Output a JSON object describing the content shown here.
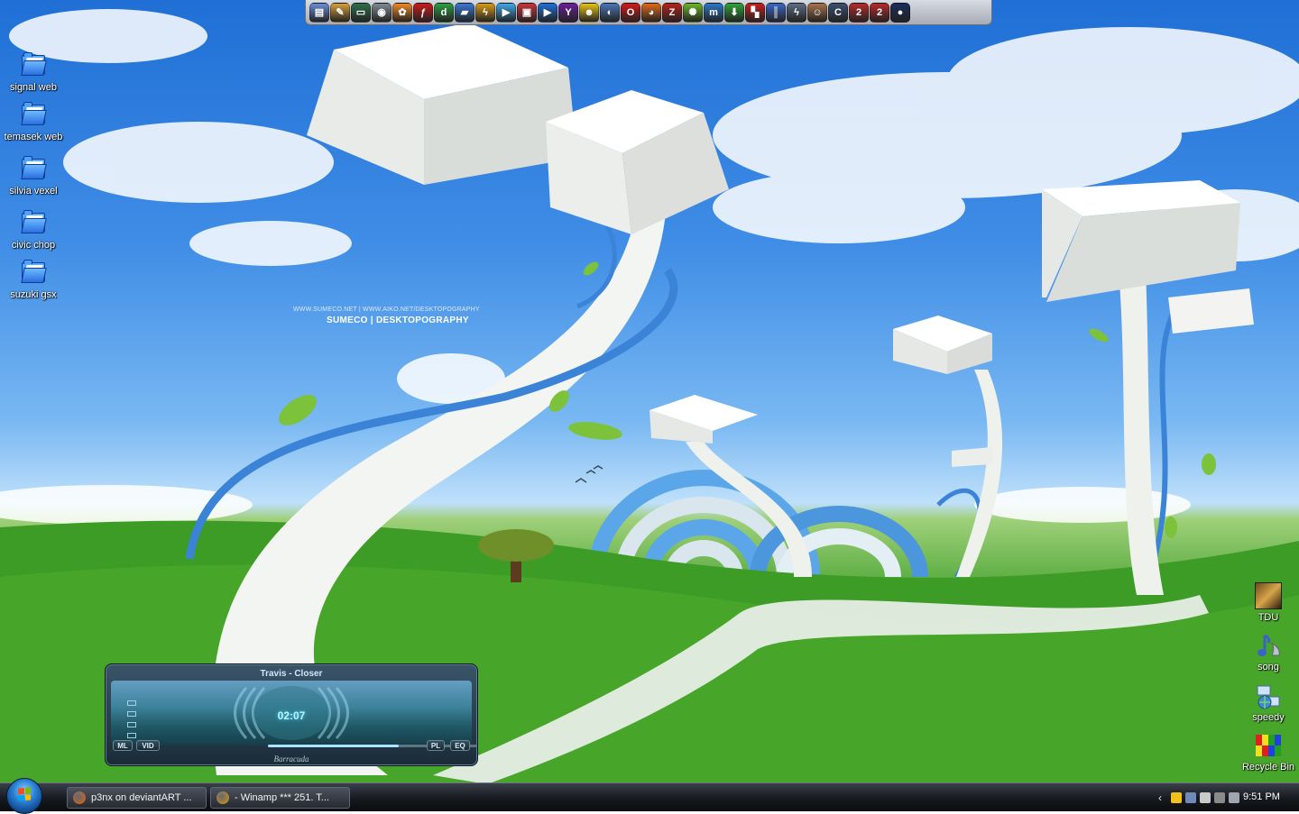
{
  "desktop": {
    "left_icons": [
      {
        "label": "signal web",
        "icon": "folder-icon"
      },
      {
        "label": "temasek web",
        "icon": "folder-icon"
      },
      {
        "label": "silvia vexel",
        "icon": "folder-icon"
      },
      {
        "label": "civic chop",
        "icon": "folder-icon"
      },
      {
        "label": "suzuki gsx",
        "icon": "folder-icon"
      }
    ],
    "right_icons": [
      {
        "label": "TDU",
        "icon": "game-icon"
      },
      {
        "label": "song",
        "icon": "music-icon"
      },
      {
        "label": "speedy",
        "icon": "network-icon"
      },
      {
        "label": "Recycle Bin",
        "icon": "recycle-bin-icon"
      }
    ]
  },
  "wallpaper": {
    "credit_small": "WWW.SUMECO.NET | WWW.AIKO.NET/DESKTOPOGRAPHY",
    "credit": "SUMECO | DESKTOPOGRAPHY"
  },
  "dock": {
    "icons": [
      {
        "name": "computer-icon",
        "color": "#6a8fd8",
        "glyph": "▤"
      },
      {
        "name": "paint-icon",
        "color": "#d9a13a",
        "glyph": "✎"
      },
      {
        "name": "monitor-icon",
        "color": "#2f6f4a",
        "glyph": "▭"
      },
      {
        "name": "camera-icon",
        "color": "#7f8a93",
        "glyph": "◉"
      },
      {
        "name": "flower-icon",
        "color": "#f08a24",
        "glyph": "✿"
      },
      {
        "name": "flash-icon",
        "color": "#c91b1b",
        "glyph": "ƒ"
      },
      {
        "name": "dreamweaver-icon",
        "color": "#2e9e43",
        "glyph": "d"
      },
      {
        "name": "folder-icon",
        "color": "#3b79d3",
        "glyph": "▰"
      },
      {
        "name": "winamp-icon",
        "color": "#d69b19",
        "glyph": "ϟ"
      },
      {
        "name": "media-player-icon",
        "color": "#41a8e6",
        "glyph": "▶"
      },
      {
        "name": "bag-icon",
        "color": "#c8343a",
        "glyph": "▣"
      },
      {
        "name": "play-icon",
        "color": "#1f6fd9",
        "glyph": "▶"
      },
      {
        "name": "yahoo-icon",
        "color": "#6b1f9c",
        "glyph": "Y"
      },
      {
        "name": "smiley-icon",
        "color": "#e8c417",
        "glyph": "☻"
      },
      {
        "name": "globe-icon",
        "color": "#4b76b8",
        "glyph": "◐"
      },
      {
        "name": "opera-icon",
        "color": "#d01a1a",
        "glyph": "O"
      },
      {
        "name": "firefox-icon",
        "color": "#e06a18",
        "glyph": "◕"
      },
      {
        "name": "filezilla-icon",
        "color": "#b5231b",
        "glyph": "Z"
      },
      {
        "name": "gear-icon",
        "color": "#6cb52a",
        "glyph": "✺"
      },
      {
        "name": "msn-icon",
        "color": "#2a78c9",
        "glyph": "m"
      },
      {
        "name": "download-icon",
        "color": "#2fa33a",
        "glyph": "⬇"
      },
      {
        "name": "tiles-icon",
        "color": "#c61f1f",
        "glyph": "▚"
      },
      {
        "name": "bars-icon",
        "color": "#3a66c6",
        "glyph": "║"
      },
      {
        "name": "speed-icon",
        "color": "#5d6d83",
        "glyph": "ϟ"
      },
      {
        "name": "avatar-icon",
        "color": "#a8734b",
        "glyph": "☺"
      },
      {
        "name": "notes-icon",
        "color": "#3b4f70",
        "glyph": "C"
      },
      {
        "name": "game-2-icon",
        "color": "#b62a2a",
        "glyph": "2"
      },
      {
        "name": "game-2b-icon",
        "color": "#b62a2a",
        "glyph": "2"
      },
      {
        "name": "ball-icon",
        "color": "#1a2d5c",
        "glyph": "●"
      }
    ]
  },
  "winamp": {
    "title": "Travis - Closer",
    "time": "02:07",
    "buttons": {
      "ml": "ML",
      "vid": "VID",
      "pl": "PL",
      "eq": "EQ"
    },
    "seek_fraction": 0.5,
    "skin_name": "Barracuda"
  },
  "taskbar": {
    "tasks": [
      {
        "label": "p3nx on deviantART ...",
        "icon": "firefox-icon",
        "color": "#e06a18"
      },
      {
        "label": "- Winamp *** 251. T...",
        "icon": "winamp-icon",
        "color": "#d69b19"
      }
    ],
    "tray": [
      {
        "name": "smiley-tray-icon",
        "color": "#f0c21b"
      },
      {
        "name": "network-tray-icon",
        "color": "#6f8ab8"
      },
      {
        "name": "volume-tray-icon",
        "color": "#c9c9c9"
      },
      {
        "name": "checker-tray-icon",
        "color": "#8a8a8a"
      },
      {
        "name": "wrench-tray-icon",
        "color": "#9fa6b0"
      }
    ],
    "clock": "9:51 PM"
  }
}
